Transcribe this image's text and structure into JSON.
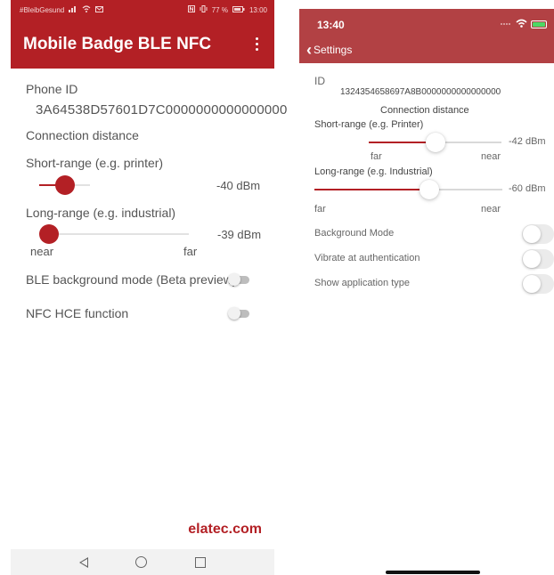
{
  "android": {
    "status_bar": {
      "left_text": "#BleibGesund",
      "right_text": "77 %",
      "time": "13:00"
    },
    "app_title": "Mobile Badge BLE NFC",
    "phone_id_label": "Phone ID",
    "phone_id_value": "3A64538D57601D7C0000000000000000",
    "connection_distance_label": "Connection distance",
    "short_range": {
      "label": "Short-range (e.g. printer)",
      "value_text": "-40 dBm",
      "level_percent": 50
    },
    "long_range": {
      "label": "Long-range (e.g. industrial)",
      "value_text": "-39 dBm",
      "level_percent": 0,
      "min_label": "near",
      "max_label": "far"
    },
    "ble_background_label": "BLE background mode (Beta preview)",
    "ble_background_on": false,
    "nfc_hce_label": "NFC HCE function",
    "nfc_hce_on": false,
    "footer_link": "elatec.com",
    "accent_color": "#b32025"
  },
  "ios": {
    "status_bar": {
      "time": "13:40"
    },
    "back_label": "Settings",
    "id_label": "ID",
    "id_value": "1324354658697A8B0000000000000000",
    "connection_distance_label": "Connection distance",
    "short_range": {
      "label": "Short-range  (e.g. Printer)",
      "value_text": "-42 dBm",
      "level_percent": 50,
      "min_label": "far",
      "max_label": "near"
    },
    "long_range": {
      "label": "Long-range (e.g. Industrial)",
      "value_text": "-60 dBm",
      "level_percent": 61,
      "min_label": "far",
      "max_label": "near"
    },
    "background_mode_label": "Background Mode",
    "background_mode_on": false,
    "vibrate_label": "Vibrate at authentication",
    "vibrate_on": false,
    "show_app_type_label": "Show application type",
    "show_app_type_on": false,
    "header_color": "#b24144"
  }
}
